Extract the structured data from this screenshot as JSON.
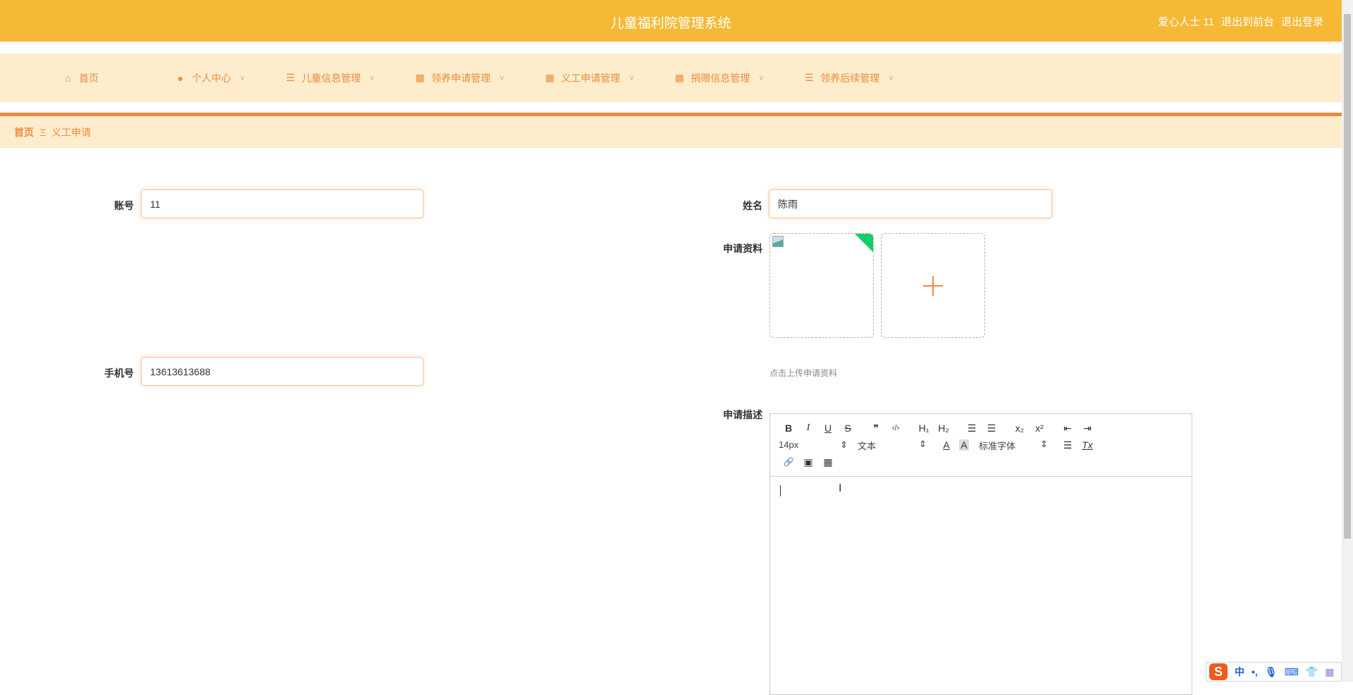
{
  "header": {
    "title": "儿童福利院管理系统",
    "user": "爱心人士 11",
    "to_front": "退出到前台",
    "logout": "退出登录"
  },
  "nav": [
    {
      "label": "首页",
      "icon": "home-icon"
    },
    {
      "label": "个人中心",
      "icon": "user-icon",
      "dropdown": true
    },
    {
      "label": "儿童信息管理",
      "icon": "list-icon",
      "dropdown": true
    },
    {
      "label": "领养申请管理",
      "icon": "grid-icon",
      "dropdown": true
    },
    {
      "label": "义工申请管理",
      "icon": "grid-icon",
      "dropdown": true
    },
    {
      "label": "捐赠信息管理",
      "icon": "grid-icon",
      "dropdown": true
    },
    {
      "label": "领养后续管理",
      "icon": "list-icon",
      "dropdown": true
    }
  ],
  "breadcrumb": {
    "home": "首页",
    "sep": "Ξ",
    "current": "义工申请"
  },
  "form": {
    "account_label": "账号",
    "account_value": "11",
    "name_label": "姓名",
    "name_value": "陈雨",
    "phone_label": "手机号",
    "phone_value": "13613613688",
    "material_label": "申请资料",
    "upload_tip": "点击上传申请资料",
    "desc_label": "申请描述"
  },
  "editor": {
    "font_size": "14px",
    "header_select": "文本",
    "font_family": "标准字体",
    "buttons": {
      "bold": "B",
      "italic": "I",
      "underline": "U",
      "strike": "S",
      "quote": "❞",
      "code": "‹/›",
      "h1": "H₁",
      "h2": "H₂",
      "ol": "☰",
      "ul": "☰",
      "sub": "x₂",
      "sup": "x²",
      "outdent": "⇤",
      "indent": "⇥",
      "color": "A",
      "bg": "A",
      "align": "☰",
      "clean": "Tx",
      "link": "🔗",
      "image": "▣",
      "video": "▦"
    }
  },
  "ime": {
    "lang": "中",
    "punct": "•,"
  }
}
